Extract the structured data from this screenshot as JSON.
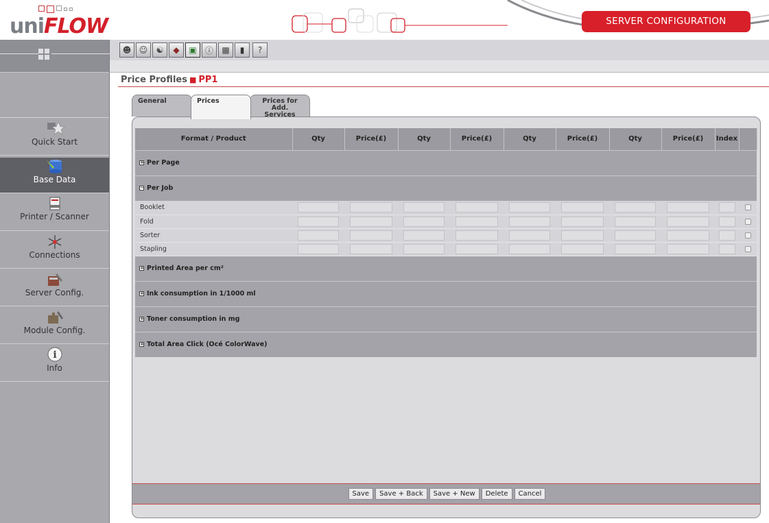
{
  "header": {
    "logo_uni": "uni",
    "logo_flow": "FLOW",
    "badge": "SERVER CONFIGURATION",
    "colors": {
      "accent": "#d8202a",
      "sidebar": "#a8a8ad",
      "sidebar_active": "#5f5f66",
      "panel": "#dcdcdf"
    }
  },
  "toolbar": {
    "icons": [
      "user-icon",
      "users-icon",
      "user-group-icon",
      "book-icon",
      "price-list-icon",
      "info-card-icon",
      "bag-icon",
      "statistics-icon",
      "help-icon"
    ]
  },
  "sidebar": {
    "items": [
      {
        "label": "Quick Start",
        "icon": "star-icon",
        "active": false
      },
      {
        "label": "Base Data",
        "icon": "database-icon",
        "active": true
      },
      {
        "label": "Printer / Scanner",
        "icon": "printer-icon",
        "active": false
      },
      {
        "label": "Connections",
        "icon": "connections-icon",
        "active": false
      },
      {
        "label": "Server Config.",
        "icon": "server-config-icon",
        "active": false
      },
      {
        "label": "Module Config.",
        "icon": "module-config-icon",
        "active": false
      },
      {
        "label": "Info",
        "icon": "info-icon",
        "active": false
      }
    ]
  },
  "breadcrumb": {
    "section": "Price Profiles",
    "current": "PP1"
  },
  "tabs": [
    {
      "label": "General",
      "active": false
    },
    {
      "label": "Prices",
      "active": true
    },
    {
      "label": "Prices for Add. Services",
      "active": false
    }
  ],
  "table": {
    "columns": [
      "Format / Product",
      "Qty",
      "Price(£)",
      "Qty",
      "Price(£)",
      "Qty",
      "Price(£)",
      "Qty",
      "Price(£)",
      "Index",
      ""
    ],
    "groups": [
      {
        "label": "Per Page",
        "expanded": false,
        "toggle": "+",
        "items": []
      },
      {
        "label": "Per Job",
        "expanded": true,
        "toggle": "−",
        "items": [
          "Booklet",
          "Fold",
          "Sorter",
          "Stapling"
        ]
      },
      {
        "label": "Printed Area per cm²",
        "expanded": false,
        "toggle": "+",
        "items": []
      },
      {
        "label": "Ink consumption in 1/1000 ml",
        "expanded": false,
        "toggle": "+",
        "items": []
      },
      {
        "label": "Toner consumption in mg",
        "expanded": false,
        "toggle": "+",
        "items": []
      },
      {
        "label": "Total Area Click (Océ ColorWave)",
        "expanded": false,
        "toggle": "+",
        "items": []
      }
    ]
  },
  "footer": {
    "buttons": [
      "Save",
      "Save + Back",
      "Save + New",
      "Delete",
      "Cancel"
    ]
  }
}
